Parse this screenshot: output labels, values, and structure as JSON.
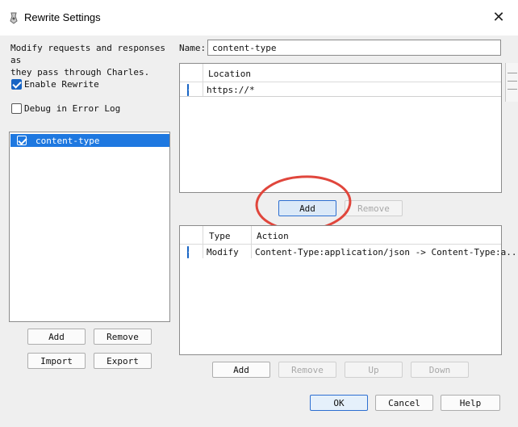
{
  "window": {
    "title": "Rewrite Settings",
    "close_label": "✕"
  },
  "left": {
    "description": "Modify requests and responses as\nthey pass through Charles.",
    "enable_rewrite_label": "Enable Rewrite",
    "enable_rewrite_checked": true,
    "debug_label": "Debug in Error Log",
    "debug_checked": false,
    "sets": [
      {
        "label": "content-type",
        "checked": true,
        "selected": true
      }
    ],
    "buttons": {
      "add": "Add",
      "remove": "Remove",
      "import": "Import",
      "export": "Export"
    }
  },
  "name": {
    "label": "Name:",
    "value": "content-type"
  },
  "locations": {
    "header": "Location",
    "rows": [
      {
        "checked": true,
        "location": "https://*"
      }
    ],
    "buttons": {
      "add": "Add",
      "remove": "Remove"
    }
  },
  "rules": {
    "headers": {
      "type": "Type",
      "action": "Action"
    },
    "rows": [
      {
        "checked": true,
        "type": "Modify",
        "action": "Content-Type:application/json -> Content-Type:a..."
      }
    ],
    "buttons": {
      "add": "Add",
      "remove": "Remove",
      "up": "Up",
      "down": "Down"
    }
  },
  "footer": {
    "ok": "OK",
    "cancel": "Cancel",
    "help": "Help"
  },
  "colors": {
    "accent": "#1764c4",
    "selection": "#1e78e0",
    "annotation": "#e0463c"
  }
}
